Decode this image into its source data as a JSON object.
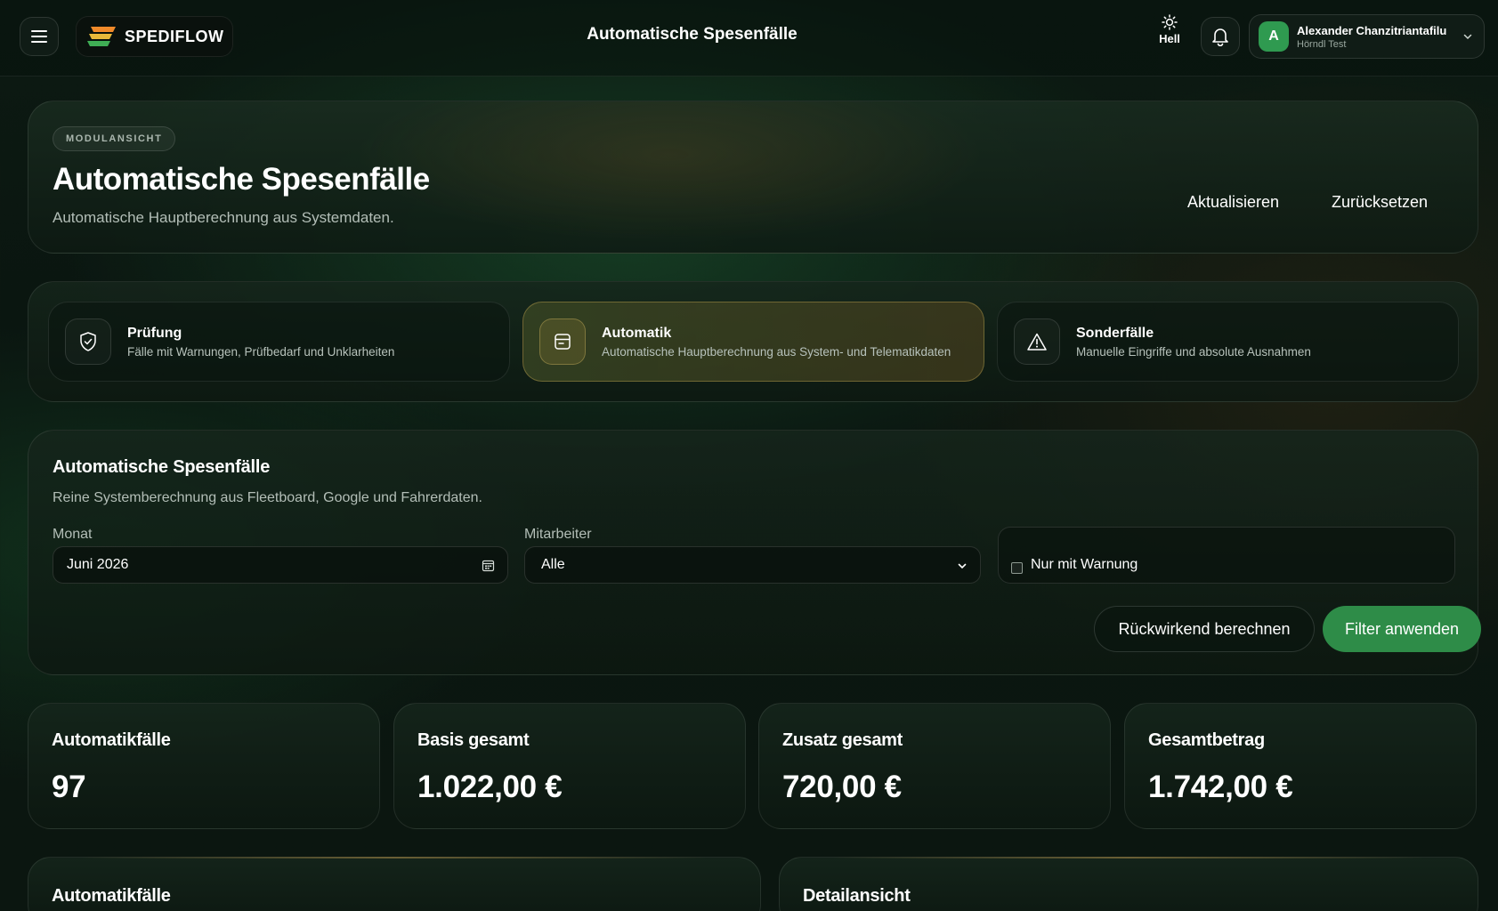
{
  "header": {
    "logo_text": "SPEDIFLOW",
    "title": "Automatische Spesenfälle",
    "theme_label": "Hell",
    "user": {
      "initial": "A",
      "name": "Alexander Chanzitriantafilu",
      "company": "Hörndl Test"
    }
  },
  "hero": {
    "badge": "MODULANSICHT",
    "title": "Automatische Spesenfälle",
    "subtitle": "Automatische Hauptberechnung aus Systemdaten.",
    "refresh_label": "Aktualisieren",
    "reset_label": "Zurücksetzen"
  },
  "tabs": [
    {
      "title": "Prüfung",
      "description": "Fälle mit Warnungen, Prüfbedarf und Unklarheiten",
      "icon": "shield-check-icon",
      "active": false
    },
    {
      "title": "Automatik",
      "description": "Automatische Hauptberechnung aus System- und Telematikdaten",
      "icon": "automation-box-icon",
      "active": true
    },
    {
      "title": "Sonderfälle",
      "description": "Manuelle Eingriffe und absolute Ausnahmen",
      "icon": "warning-triangle-icon",
      "active": false
    }
  ],
  "filters": {
    "title": "Automatische Spesenfälle",
    "subtitle": "Reine Systemberechnung aus Fleetboard, Google und Fahrerdaten.",
    "month_label": "Monat",
    "month_value": "Juni 2026",
    "employee_label": "Mitarbeiter",
    "employee_value": "Alle",
    "warning_only_label": "Nur mit Warnung",
    "warning_only_checked": false,
    "recalc_label": "Rückwirkend berechnen",
    "apply_label": "Filter anwenden"
  },
  "stats": [
    {
      "label": "Automatikfälle",
      "value": "97"
    },
    {
      "label": "Basis gesamt",
      "value": "1.022,00 €"
    },
    {
      "label": "Zusatz gesamt",
      "value": "720,00 €"
    },
    {
      "label": "Gesamtbetrag",
      "value": "1.742,00 €"
    }
  ],
  "sections": {
    "list_title": "Automatikfälle",
    "detail_title": "Detailansicht"
  },
  "colors": {
    "accent_green": "#2e8c48",
    "avatar_green": "#2f9a50",
    "active_tab_border": "#a08c46"
  }
}
